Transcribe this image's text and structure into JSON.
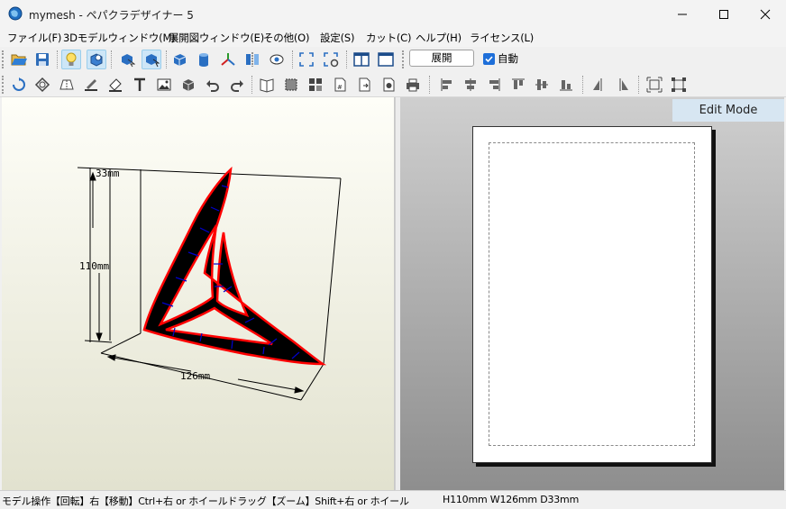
{
  "window": {
    "title": "mymesh - ペパクラデザイナー 5",
    "app_icon": "globe-icon"
  },
  "menu": [
    "ファイル(F)",
    "3Dモデルウィンドウ(M)",
    "展開図ウィンドウ(E)",
    "その他(O)",
    "設定(S)",
    "カット(C)",
    "ヘルプ(H)",
    "ライセンス(L)"
  ],
  "toolbar": {
    "expand_label": "展開",
    "auto_label": "自動",
    "auto_checked": true
  },
  "view3d": {
    "dim_height": "110mm",
    "dim_width": "126mm",
    "dim_depth": "33mm",
    "edge_color": "#ff0000",
    "fold_color": "#0000cc",
    "fill_color": "#000000"
  },
  "view2d": {
    "mode_label": "Edit Mode"
  },
  "status": {
    "hint": "モデル操作【回転】右【移動】Ctrl+右 or ホイールドラッグ【ズーム】Shift+右 or ホイール",
    "size": "H110mm W126mm D33mm"
  }
}
